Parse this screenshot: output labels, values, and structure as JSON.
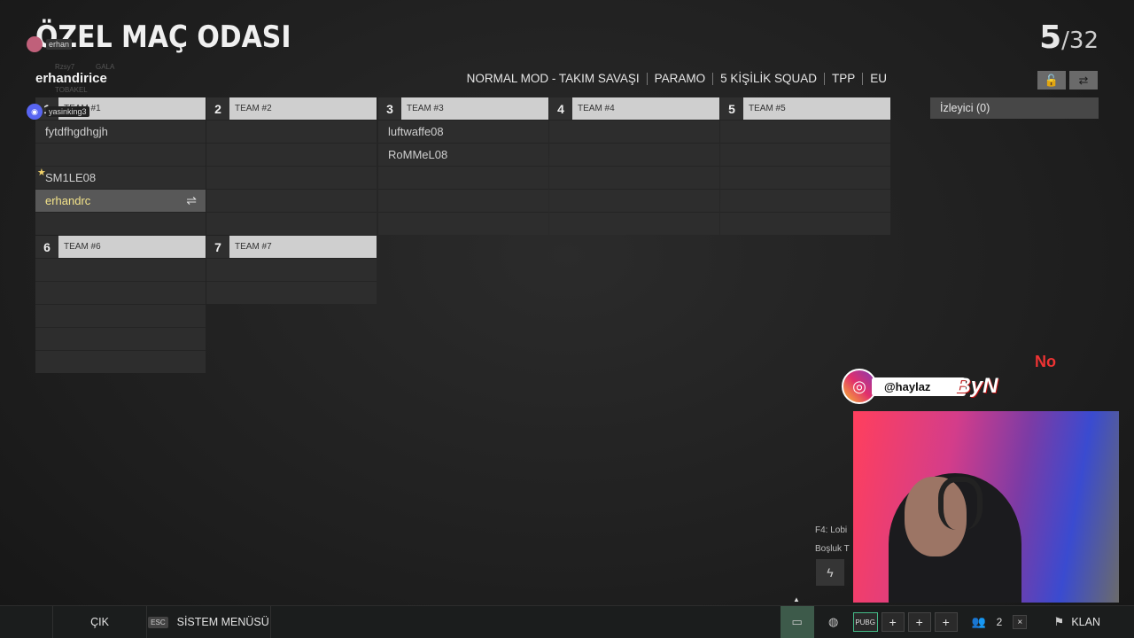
{
  "header": {
    "title": "ÖZEL MAÇ ODASI",
    "host": "erhandirice",
    "counter_current": "5",
    "counter_total": "/32"
  },
  "overlays": {
    "top_user_tag": "erhan",
    "ghost_lines": [
      "Rzsy7",
      "GALA",
      "TOBAKEL"
    ],
    "discord_user": "yasinking3"
  },
  "modes": [
    "NORMAL MOD - TAKIM SAVAŞI",
    "PARAMO",
    "5 KİŞİLİK SQUAD",
    "TPP",
    "EU"
  ],
  "top_buttons": {
    "lock_icon": "lock-open-icon",
    "swap_icon": "swap-icon"
  },
  "teams": [
    {
      "num": "1",
      "name": "TEAM #1",
      "slots": [
        "fytdfhgdhgjh",
        "",
        "SM1LE08",
        "erhandrc",
        ""
      ]
    },
    {
      "num": "2",
      "name": "TEAM #2",
      "slots": [
        "",
        "",
        "",
        "",
        ""
      ]
    },
    {
      "num": "3",
      "name": "TEAM #3",
      "slots": [
        "luftwaffe08",
        "RoMMeL08",
        "",
        "",
        ""
      ]
    },
    {
      "num": "4",
      "name": "TEAM #4",
      "slots": [
        "",
        "",
        "",
        "",
        ""
      ]
    },
    {
      "num": "5",
      "name": "TEAM #5",
      "slots": [
        "",
        "",
        "",
        "",
        ""
      ]
    },
    {
      "num": "6",
      "name": "TEAM #6",
      "slots": [
        "",
        "",
        "",
        "",
        ""
      ]
    },
    {
      "num": "7",
      "name": "TEAM #7",
      "slots": [
        "",
        ""
      ]
    }
  ],
  "spectator": "İzleyici (0)",
  "social": {
    "instagram": "@haylaz",
    "brand": "ByN",
    "brand2": "No"
  },
  "chat": {
    "hint1": "F4: Lobi",
    "hint2": "Boşluk T"
  },
  "bottom": {
    "exit": "ÇIK",
    "esc_key": "ESC",
    "system_menu": "SİSTEM MENÜSÜ",
    "pubg_tag": "PUBG",
    "friends_count": "2",
    "clan": "KLAN"
  }
}
